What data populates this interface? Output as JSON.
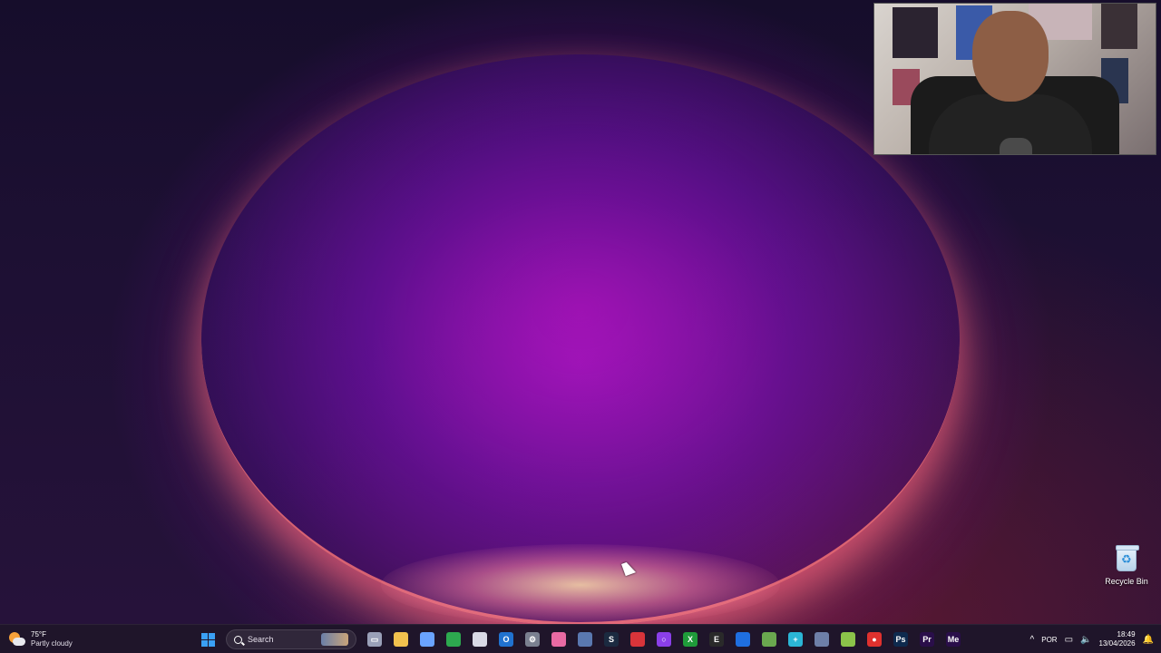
{
  "desktop": {
    "recycle_bin_label": "Recycle Bin"
  },
  "taskbar": {
    "weather": {
      "temperature": "75°F",
      "condition": "Partly cloudy"
    },
    "search": {
      "placeholder": "Search"
    },
    "pinned": [
      {
        "name": "task-view",
        "icon": "task-view-icon",
        "color": "#9aa0b8",
        "glyph": "▭"
      },
      {
        "name": "file-explorer",
        "icon": "folder-icon",
        "color": "#f2c14e",
        "glyph": ""
      },
      {
        "name": "copilot",
        "icon": "copilot-icon",
        "color": "#6aa3ff",
        "glyph": ""
      },
      {
        "name": "chrome",
        "icon": "chrome-icon",
        "color": "#2da94f",
        "glyph": ""
      },
      {
        "name": "store",
        "icon": "store-icon",
        "color": "#d9d9e6",
        "glyph": ""
      },
      {
        "name": "outlook",
        "icon": "outlook-icon",
        "color": "#2072d0",
        "glyph": "O"
      },
      {
        "name": "settings",
        "icon": "gear-icon",
        "color": "#7a8090",
        "glyph": "⚙"
      },
      {
        "name": "pink-app",
        "icon": "pink-app-icon",
        "color": "#e86aa3",
        "glyph": ""
      },
      {
        "name": "photos",
        "icon": "photos-icon",
        "color": "#5a78b0",
        "glyph": ""
      },
      {
        "name": "steam",
        "icon": "steam-icon",
        "color": "#1b2a40",
        "glyph": "S"
      },
      {
        "name": "red-app",
        "icon": "red-app-icon",
        "color": "#d8343a",
        "glyph": ""
      },
      {
        "name": "circle-app",
        "icon": "circle-app-icon",
        "color": "#8a3fe8",
        "glyph": "○"
      },
      {
        "name": "xbox",
        "icon": "xbox-icon",
        "color": "#1f9b3a",
        "glyph": "X"
      },
      {
        "name": "epic-games",
        "icon": "epic-games-icon",
        "color": "#2a2a2a",
        "glyph": "E"
      },
      {
        "name": "blue-app",
        "icon": "blue-app-icon",
        "color": "#1f6fe0",
        "glyph": ""
      },
      {
        "name": "green-app",
        "icon": "green-app-icon",
        "color": "#6aa84f",
        "glyph": ""
      },
      {
        "name": "cyan-app",
        "icon": "cyan-app-icon",
        "color": "#2bb6d6",
        "glyph": "+"
      },
      {
        "name": "network-app",
        "icon": "network-app-icon",
        "color": "#6e7fa8",
        "glyph": ""
      },
      {
        "name": "android-app",
        "icon": "android-icon",
        "color": "#8bc34a",
        "glyph": ""
      },
      {
        "name": "record-app",
        "icon": "record-icon",
        "color": "#e0312e",
        "glyph": "●"
      },
      {
        "name": "photoshop",
        "icon": "photoshop-icon",
        "color": "#0e2a4e",
        "glyph": "Ps"
      },
      {
        "name": "premiere",
        "icon": "premiere-icon",
        "color": "#2a0e4a",
        "glyph": "Pr"
      },
      {
        "name": "media-encoder",
        "icon": "media-encoder-icon",
        "color": "#2a0e4a",
        "glyph": "Me"
      }
    ],
    "tray": {
      "language": "POR",
      "time": "18:49",
      "date": "13/04/2026"
    }
  }
}
